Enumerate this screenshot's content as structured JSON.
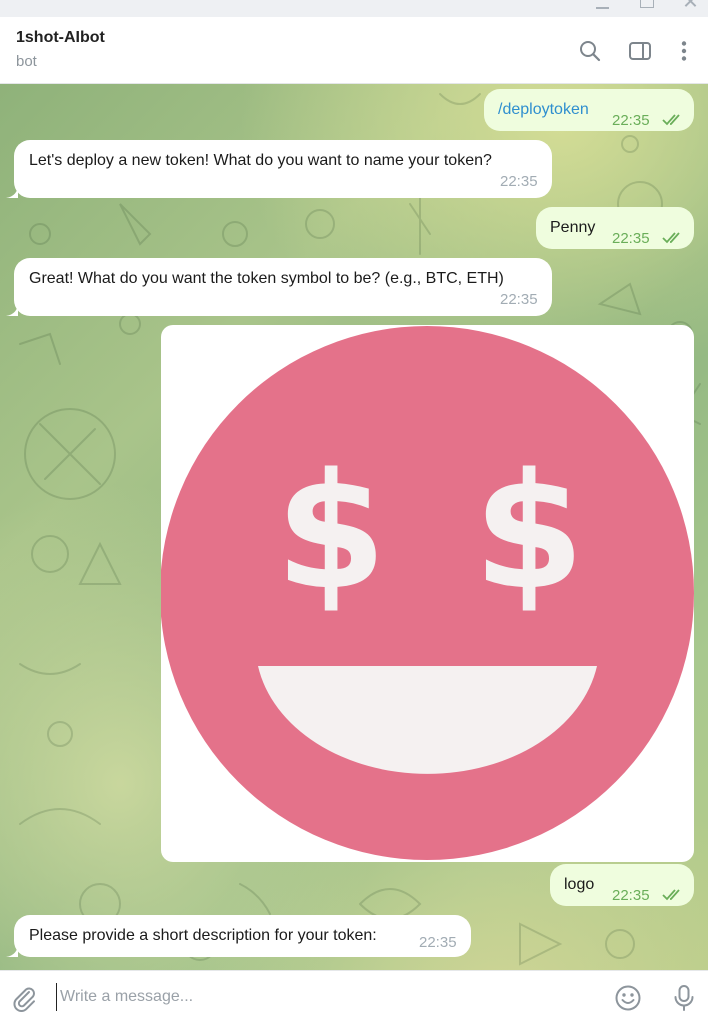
{
  "window": {
    "controls": [
      "minimize-icon",
      "maximize-icon",
      "close-icon"
    ]
  },
  "header": {
    "name": "1shot-AIbot",
    "status": "bot",
    "icons": [
      "search-icon",
      "sidebar-panel-icon",
      "more-vertical-icon"
    ]
  },
  "messages": [
    {
      "direction": "out",
      "text": "/deploytoken",
      "time": "22:35",
      "read": true
    },
    {
      "direction": "in",
      "text": "Let's deploy a new token! What do you want to name your token?",
      "time": "22:35"
    },
    {
      "direction": "out",
      "text": "Penny",
      "time": "22:35",
      "read": true
    },
    {
      "direction": "in",
      "text": "Great! What do you want the token symbol to be? (e.g., BTC, ETH)",
      "time": "22:35"
    },
    {
      "direction": "out",
      "type": "image",
      "image": "smiley-dollar-eyes-logo",
      "colors": {
        "face": "#e4728a",
        "features": "#f5f1f1"
      }
    },
    {
      "direction": "out",
      "text": "logo",
      "time": "22:35",
      "read": true
    },
    {
      "direction": "in",
      "text": "Please provide a short description for your token:",
      "time": "22:35"
    }
  ],
  "input": {
    "placeholder": "Write a message...",
    "icons": [
      "attach-paperclip-icon",
      "emoji-icon",
      "microphone-icon"
    ]
  },
  "colors": {
    "incoming_bubble": "#ffffff",
    "outgoing_bubble": "#effdde",
    "outgoing_time": "#6aae59",
    "link": "#2f8fcf"
  }
}
